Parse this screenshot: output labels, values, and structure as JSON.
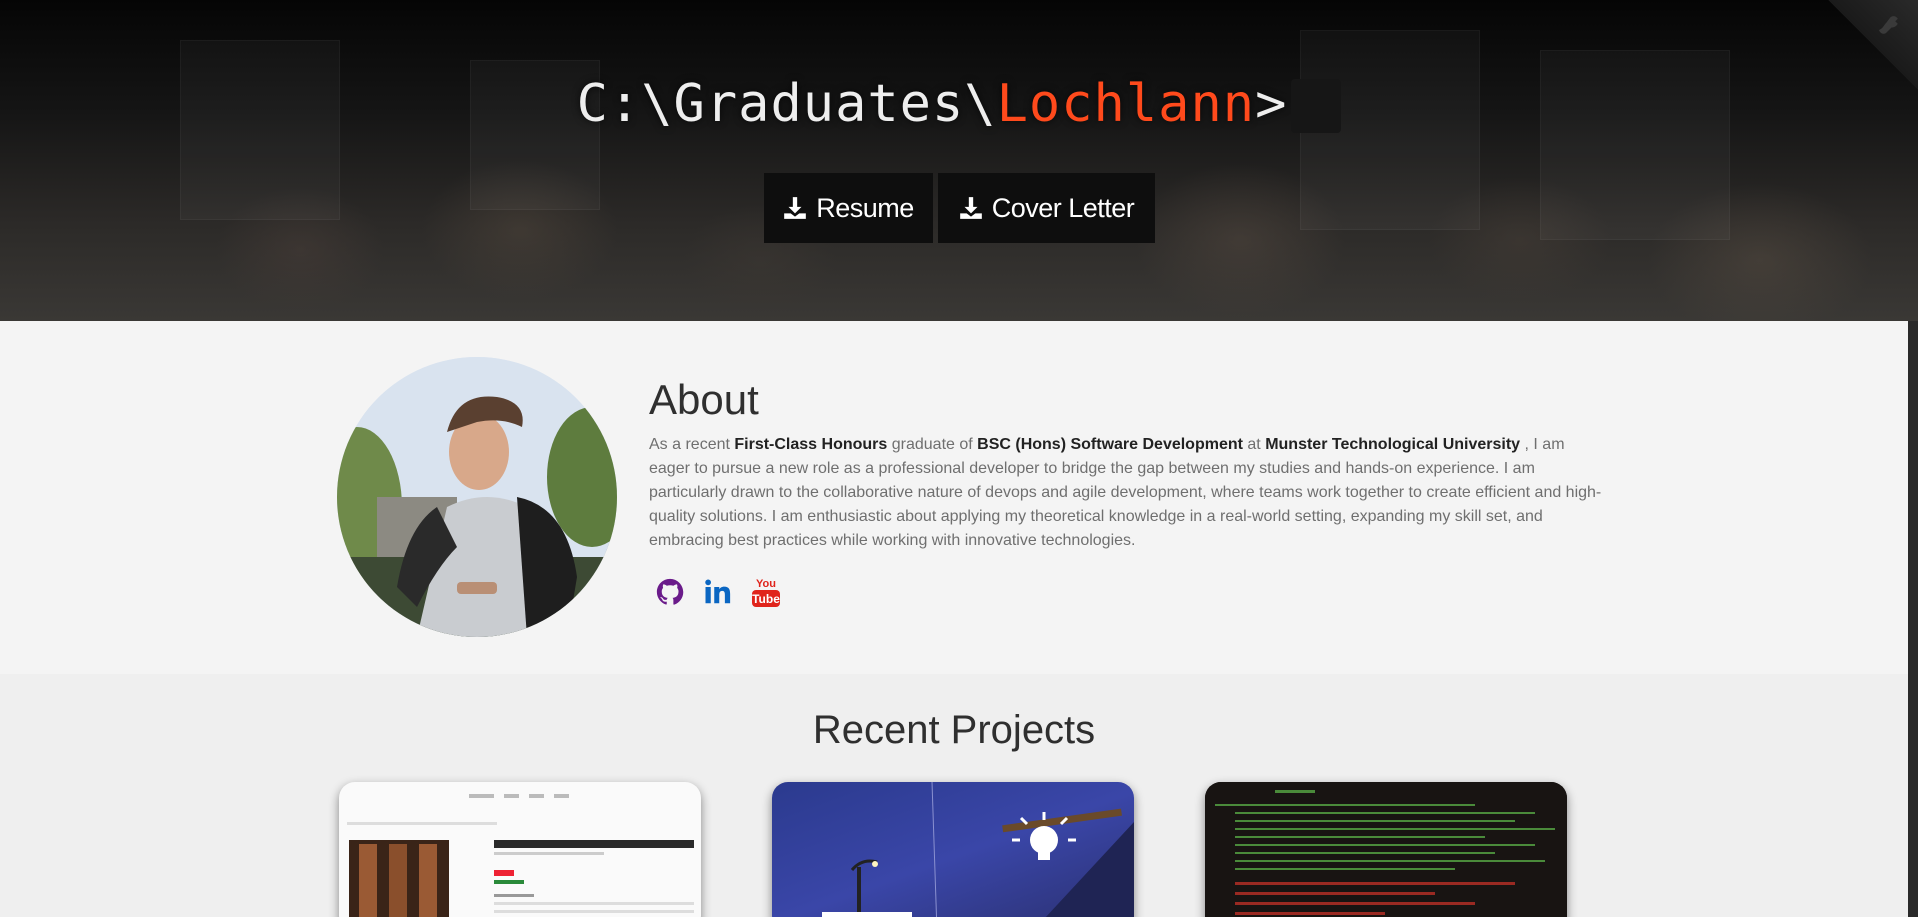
{
  "hero": {
    "prompt_prefix": "C:\\Graduates\\",
    "name": "Lochlann",
    "prompt_suffix": ">",
    "buttons": {
      "resume": "Resume",
      "cover_letter": "Cover Letter"
    }
  },
  "about": {
    "title": "About",
    "text": {
      "p1": "As a recent ",
      "b1": "First-Class Honours",
      "p2": " graduate of ",
      "b2": "BSC (Hons) Software Development",
      "p3": " at ",
      "b3": "Munster Technological University",
      "p4": " , I am eager to pursue a new role as a professional developer to bridge the gap between my studies and hands-on experience. I am particularly drawn to the collaborative nature of devops and agile development, where teams work together to create efficient and high-quality solutions. I am enthusiastic about applying my theoretical knowledge in a real-world setting, expanding my skill set, and embracing best practices while working with innovative technologies."
    },
    "socials": [
      {
        "icon": "github-icon",
        "color": "#6a1b8a"
      },
      {
        "icon": "linkedin-icon",
        "color": "#0a66c2"
      },
      {
        "icon": "youtube-icon",
        "color": "#e0241b"
      }
    ]
  },
  "projects": {
    "title": "Recent Projects"
  },
  "colors": {
    "accent": "#ff4a1c",
    "hero_button_bg": "#0e0e0e",
    "about_bg": "#f4f4f4",
    "page_bg": "#efefef"
  }
}
